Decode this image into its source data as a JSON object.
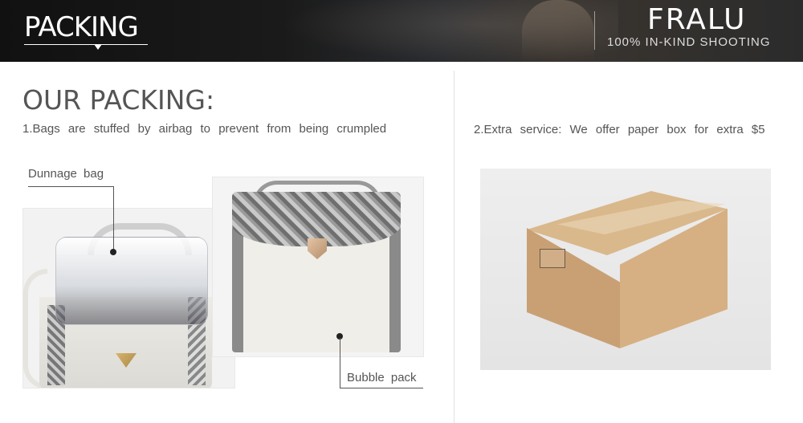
{
  "banner": {
    "section_title": "PACKING",
    "brand": "FRALU",
    "brand_tagline": "100% IN-KIND SHOOTING"
  },
  "main": {
    "title": "OUR PACKING:",
    "note_1": "1.Bags are stuffed by airbag to prevent from being crumpled",
    "note_2": "2.Extra service: We offer paper box for extra $5",
    "annotation_dunnage": "Dunnage bag",
    "annotation_bubble": "Bubble pack"
  },
  "icons": {
    "caret": "caret-down-icon",
    "pointer_dot": "dot-icon"
  }
}
